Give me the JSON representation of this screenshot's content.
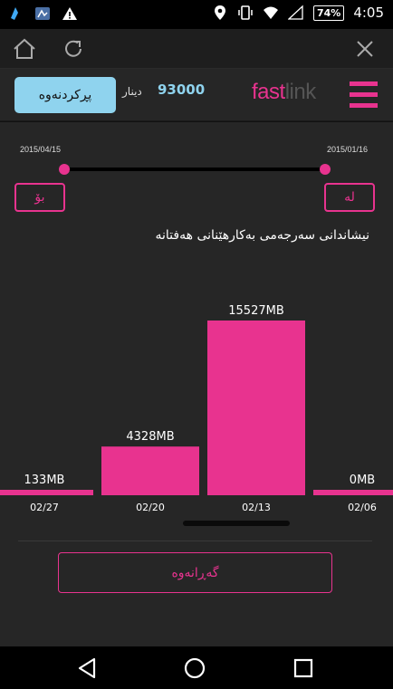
{
  "status_bar": {
    "battery": "74%",
    "time": "4:05"
  },
  "header": {
    "refresh_label": "پڕکردنەوە",
    "currency": "دینار",
    "balance": "93000",
    "logo_part1": "fast",
    "logo_part2": "link"
  },
  "date_range": {
    "start_date": "2015/04/15",
    "end_date": "2015/01/16",
    "to_label": "بۆ",
    "from_label": "لە"
  },
  "chart_title": "نیشاندانی سەرجەمی بەکارهێنانی هەفتانە",
  "chart_data": {
    "type": "bar",
    "title": "نیشاندانی سەرجەمی بەکارهێنانی هەفتانە",
    "categories": [
      "02/27",
      "02/20",
      "02/13",
      "02/06"
    ],
    "values": [
      133,
      4328,
      15527,
      0
    ],
    "data_labels": [
      "133MB",
      "4328MB",
      "15527MB",
      "0MB"
    ],
    "ylim": [
      0,
      15527
    ],
    "color": "#e8338f"
  },
  "back_button": "گەڕانەوە",
  "colors": {
    "accent": "#e8338f",
    "button_bg": "#8fd3ee",
    "page_bg": "#262626"
  }
}
